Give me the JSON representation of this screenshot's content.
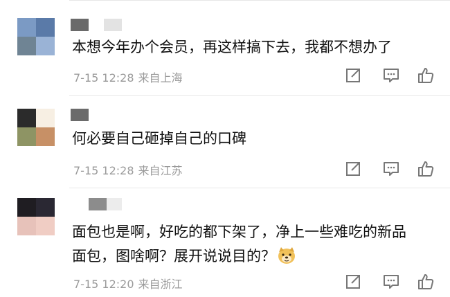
{
  "comments": [
    {
      "avatar_colors": [
        "#7b9ac4",
        "#5a7aa8",
        "#6f8494",
        "#9ab3d6"
      ],
      "username_colors": [
        "#6a6a6a",
        "#e3e3e3"
      ],
      "text": "本想今年办个会员，再这样搞下去，我都不想办了",
      "time": "7-15 12:28",
      "location": "来自上海"
    },
    {
      "avatar_colors": [
        "#2b2b2b",
        "#f7efe3",
        "#8e9464",
        "#c79066"
      ],
      "username_colors": [
        "#6b6b6b"
      ],
      "text": "何必要自己砸掉自己的口碑",
      "time": "7-15 12:28",
      "location": "来自江苏"
    },
    {
      "avatar_colors": [
        "#1f1d22",
        "#2a2833",
        "#e7c2ba",
        "#f0cdc4"
      ],
      "username_colors": [
        "#8c8c8c",
        "#ececec"
      ],
      "text_line1": "面包也是啊，好吃的都下架了，净上一些难吃的新品",
      "text_line2": "面包，图啥啊？展开说说目的？",
      "emoji": "doge-emoji",
      "time": "7-15 12:20",
      "location": "来自浙江"
    }
  ],
  "icons": {
    "repost": "repost-icon",
    "comment": "comment-icon",
    "like": "like-icon"
  },
  "colors": {
    "meta_gray": "#9a9a9a",
    "icon_gray": "#777777",
    "text": "#111111"
  }
}
